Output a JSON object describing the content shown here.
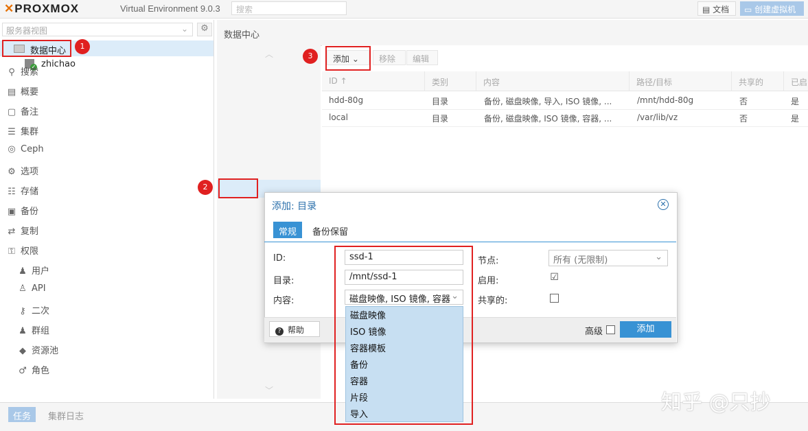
{
  "header": {
    "brand": "PROXMOX",
    "version": "Virtual Environment 9.0.3",
    "search_placeholder": "搜索",
    "docs_label": "文档",
    "create_vm_label": "创建虚拟机"
  },
  "tree": {
    "view_selector": "服务器视图",
    "datacenter": "数据中心",
    "node": "zhichao"
  },
  "breadcrumb": "数据中心",
  "menu": {
    "items": [
      "搜索",
      "概要",
      "备注",
      "集群",
      "Ceph",
      "选项",
      "存储",
      "备份",
      "复制",
      "权限"
    ],
    "sub_items": [
      "用户",
      "API",
      "二次",
      "群组",
      "资源池",
      "角色"
    ]
  },
  "toolbar": {
    "add": "添加",
    "remove": "移除",
    "edit": "编辑"
  },
  "table": {
    "columns": [
      "ID ↑",
      "类别",
      "内容",
      "路径/目标",
      "共享的",
      "已启"
    ],
    "rows": [
      [
        "hdd-80g",
        "目录",
        "备份, 磁盘映像, 导入, ISO 镜像, ...",
        "/mnt/hdd-80g",
        "否",
        "是"
      ],
      [
        "local",
        "目录",
        "备份, 磁盘映像, ISO 镜像, 容器, ...",
        "/var/lib/vz",
        "否",
        "是"
      ]
    ]
  },
  "dialog": {
    "title": "添加: 目录",
    "tabs": [
      "常规",
      "备份保留"
    ],
    "id_label": "ID:",
    "id_value": "ssd-1",
    "dir_label": "目录:",
    "dir_value": "/mnt/ssd-1",
    "content_label": "内容:",
    "content_value": "磁盘映像, ISO 镜像, 容器",
    "node_label": "节点:",
    "node_value": "所有 (无限制)",
    "enable_label": "启用:",
    "shared_label": "共享的:",
    "help_label": "帮助",
    "advanced_label": "高级",
    "add_label": "添加",
    "enabled": true,
    "shared": false,
    "advanced": false
  },
  "content_options": [
    "磁盘映像",
    "ISO 镜像",
    "容器模板",
    "备份",
    "容器",
    "片段",
    "导入"
  ],
  "footer_tabs": [
    "任务",
    "集群日志"
  ],
  "annotations": [
    "1",
    "2",
    "3"
  ],
  "watermark": "知乎 @只抄",
  "colors": {
    "accent": "#3892d4",
    "highlight": "#e02020",
    "selection": "#dcecf9"
  }
}
